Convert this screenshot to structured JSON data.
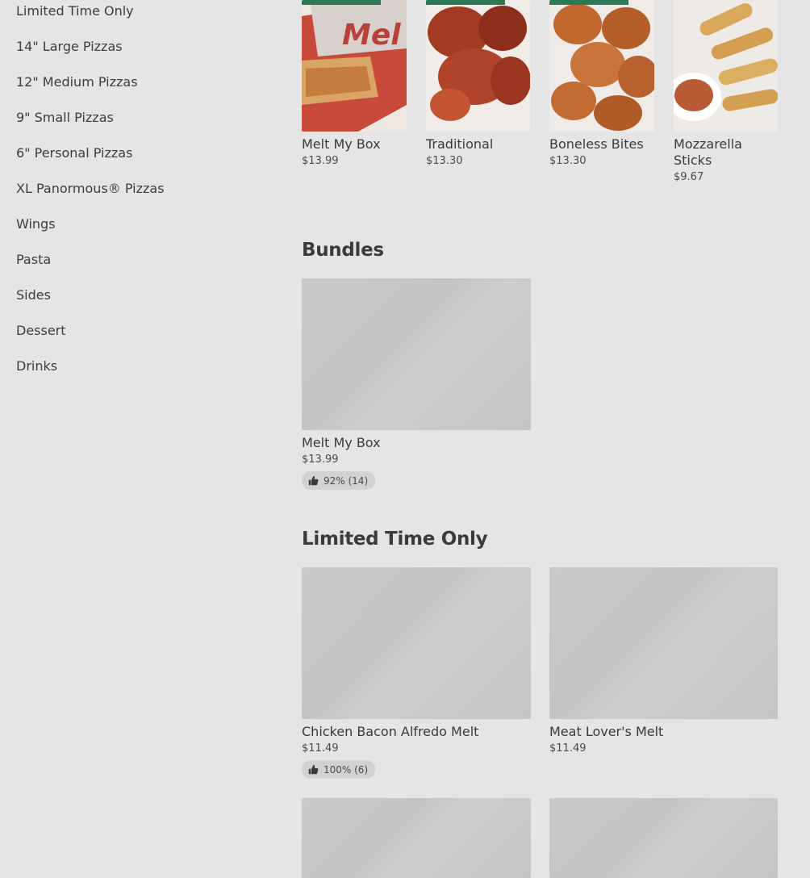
{
  "sidebar": {
    "items": [
      {
        "label": "Limited Time Only"
      },
      {
        "label": "14\" Large Pizzas"
      },
      {
        "label": "12\" Medium Pizzas"
      },
      {
        "label": "9\" Small Pizzas"
      },
      {
        "label": "6\" Personal Pizzas"
      },
      {
        "label": "XL Panormous® Pizzas"
      },
      {
        "label": "Wings"
      },
      {
        "label": "Pasta"
      },
      {
        "label": "Sides"
      },
      {
        "label": "Dessert"
      },
      {
        "label": "Drinks"
      }
    ]
  },
  "top_row": [
    {
      "name": "Melt My Box",
      "price": "$13.99"
    },
    {
      "name": "Traditional",
      "price": "$13.30"
    },
    {
      "name": "Boneless Bites",
      "price": "$13.30"
    },
    {
      "name": "Mozzarella Sticks",
      "price": "$9.67"
    }
  ],
  "bundles": {
    "title": "Bundles",
    "items": [
      {
        "name": "Melt My Box",
        "price": "$13.99",
        "rating": "92% (14)"
      }
    ]
  },
  "limited": {
    "title": "Limited Time Only",
    "items": [
      {
        "name": "Chicken Bacon Alfredo Melt",
        "price": "$11.49",
        "rating": "100% (6)"
      },
      {
        "name": "Meat Lover's Melt",
        "price": "$11.49"
      }
    ]
  },
  "colors": {
    "background": "#e5e5e5",
    "text": "#3a3a3a",
    "placeholder": "#c8c8c8",
    "tag_green": "#2c7a55"
  }
}
